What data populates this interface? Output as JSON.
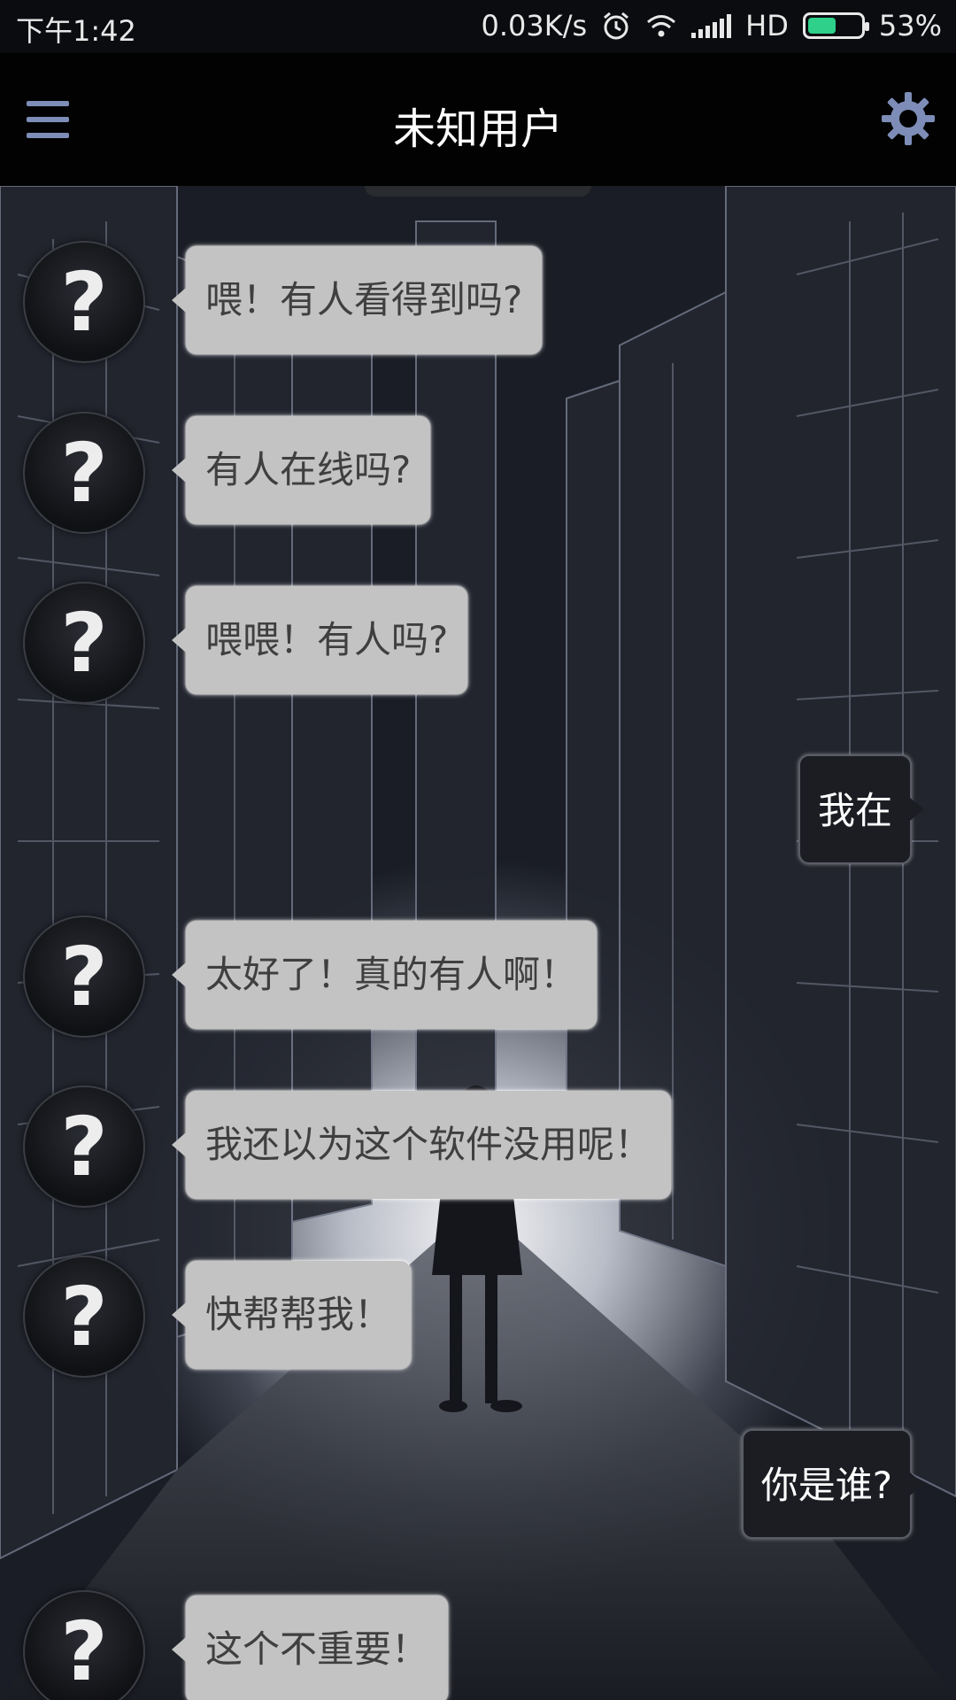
{
  "status_bar": {
    "time": "下午1:42",
    "network_speed": "0.03K/s",
    "network_type": "HD",
    "battery": "53%",
    "battery_level": 0.53
  },
  "header": {
    "title": "未知用户",
    "menu_icon": "hamburger-menu-icon",
    "settings_icon": "gear-icon",
    "accent_color": "#7d8db7"
  },
  "avatar_symbol": "?",
  "messages": [
    {
      "from": "other",
      "text": "喂！有人看得到吗?"
    },
    {
      "from": "other",
      "text": "有人在线吗?"
    },
    {
      "from": "other",
      "text": "喂喂！有人吗?"
    },
    {
      "from": "me",
      "text": "我在"
    },
    {
      "from": "other",
      "text": "太好了！真的有人啊！"
    },
    {
      "from": "other",
      "text": "我还以为这个软件没用呢！"
    },
    {
      "from": "other",
      "text": "快帮帮我！"
    },
    {
      "from": "me",
      "text": "你是谁?"
    },
    {
      "from": "other",
      "text": "这个不重要！"
    }
  ]
}
